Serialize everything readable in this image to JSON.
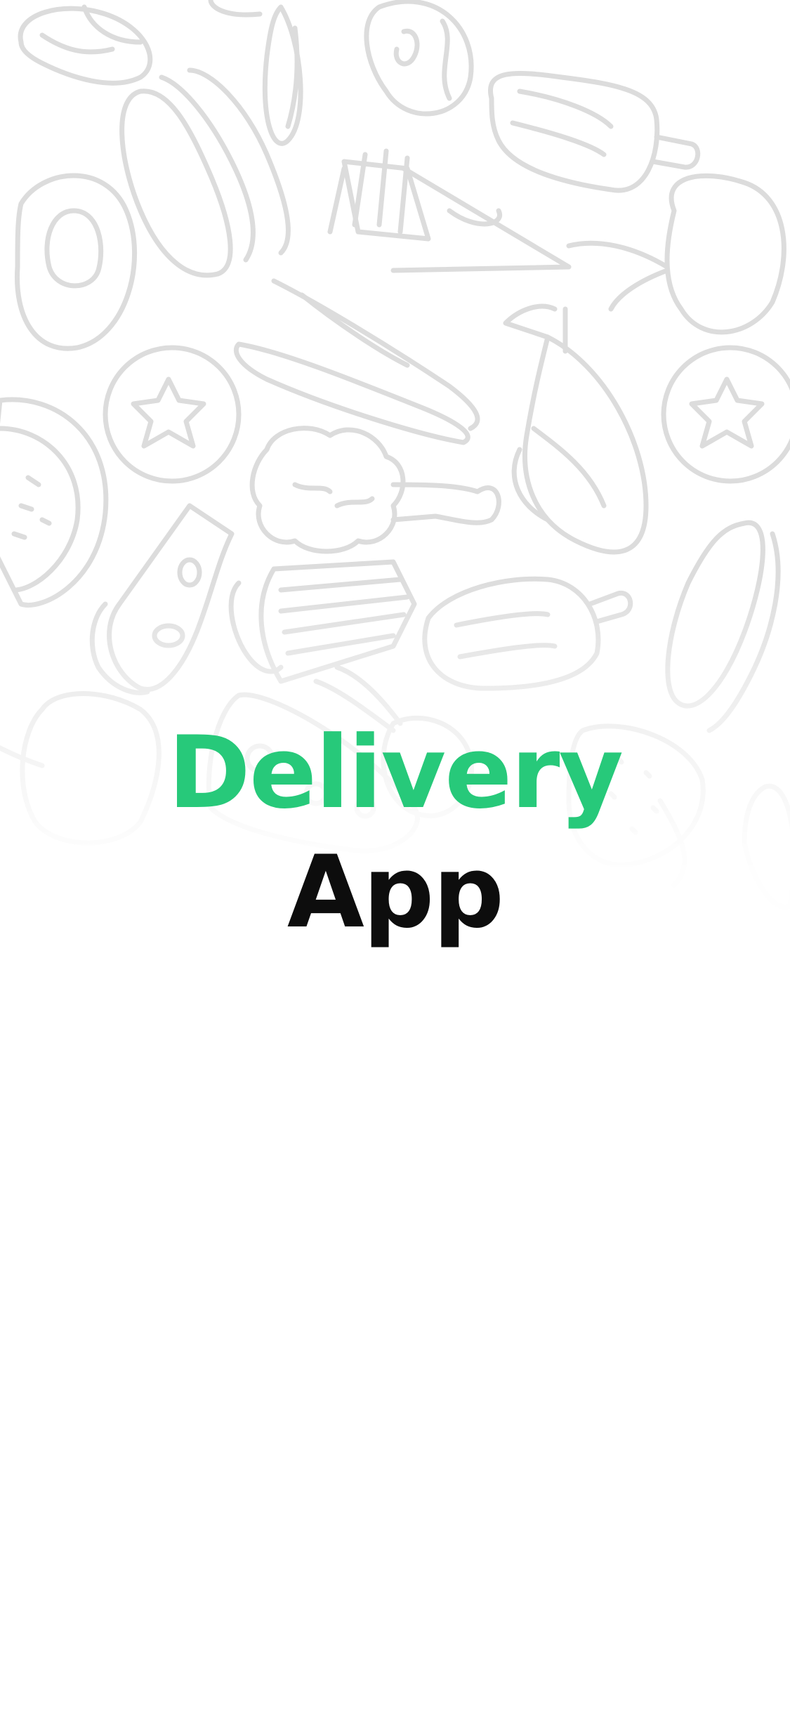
{
  "splash": {
    "title_line1": "Delivery",
    "title_line2": "App",
    "background": "food-doodle-pattern",
    "colors": {
      "accent": "#27c97a",
      "text": "#0d0d0d",
      "doodle": "#dcdcdc",
      "background": "#ffffff"
    }
  }
}
